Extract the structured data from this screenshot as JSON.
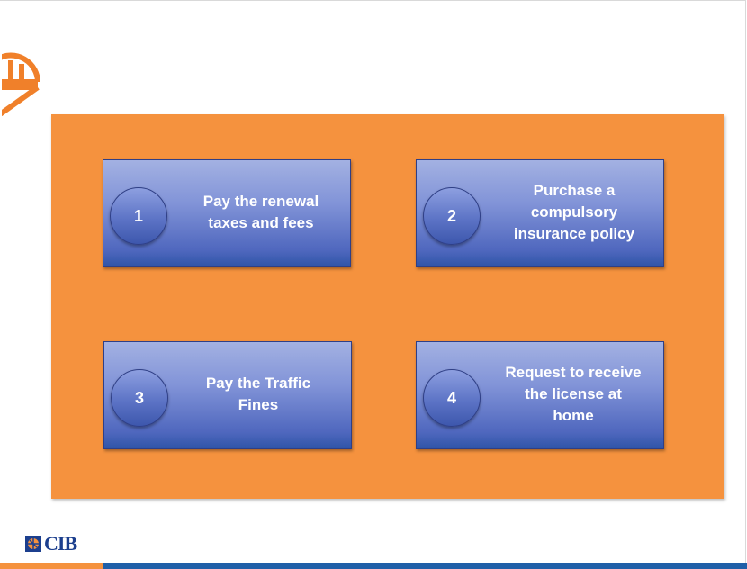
{
  "colors": {
    "accent_orange": "#f5923e",
    "card_blue": "#4f67be",
    "brand_blue": "#1c3f8e",
    "footer_blue": "#1f5fa8"
  },
  "header": {
    "logo_icon": "cib-orange-emblem-icon"
  },
  "steps": [
    {
      "number": "1",
      "lines": [
        "Pay the renewal",
        "taxes and fees"
      ]
    },
    {
      "number": "2",
      "lines": [
        "Purchase a",
        "compulsory",
        "insurance policy"
      ]
    },
    {
      "number": "3",
      "lines": [
        "Pay the Traffic",
        "Fines"
      ]
    },
    {
      "number": "4",
      "lines": [
        "Request to receive",
        "the license at",
        "home"
      ]
    }
  ],
  "footer": {
    "logo_icon": "cib-logo-icon",
    "brand": "CIB"
  }
}
